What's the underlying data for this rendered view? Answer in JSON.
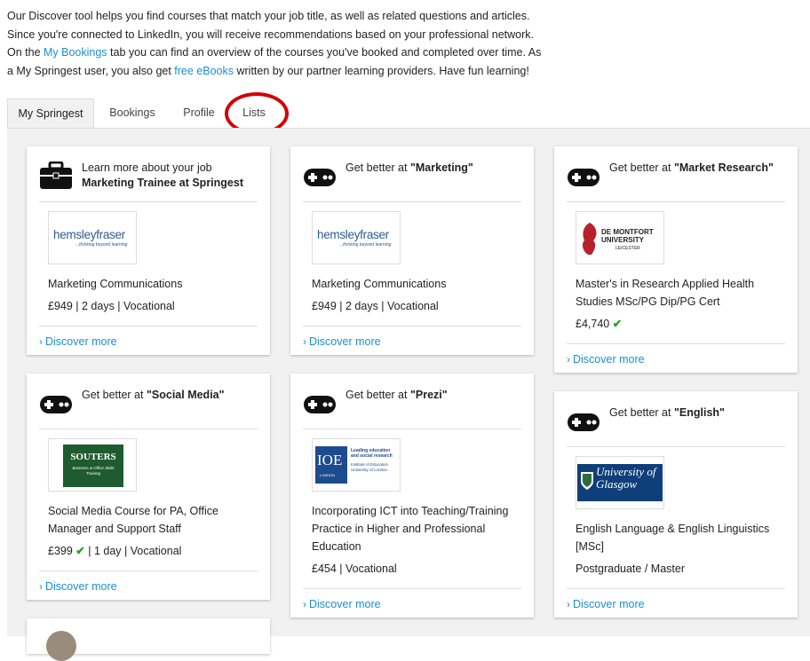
{
  "intro": {
    "part1": "Our Discover tool helps you find courses that match your job title, as well as related questions and articles. Since you're connected to LinkedIn, you will receive recommendations based on your professional network. On the ",
    "link1": "My Bookings",
    "part2": " tab you can find an overview of the courses you've booked and completed over time. As a My Springest user, you also get ",
    "link2": "free eBooks",
    "part3": " written by our partner learning providers. Have fun learning!"
  },
  "tabs": [
    {
      "label": "My Springest",
      "active": true
    },
    {
      "label": "Bookings",
      "active": false
    },
    {
      "label": "Profile",
      "active": false
    },
    {
      "label": "Lists",
      "active": false
    }
  ],
  "cards": [
    {
      "icon": "briefcase-icon",
      "head_line1": "Learn more about your job",
      "head_line2": "Marketing Trainee at Springest",
      "provider_logo": "hemsleyfraser-logo",
      "logo_text_main": "hemsleyfraser",
      "logo_text_sub": "...thinking beyond learning",
      "title": "Marketing Communications",
      "meta": "£949 | 2 days | Vocational",
      "discover": "Discover more"
    },
    {
      "icon": "gamepad-icon",
      "head_prefix": "Get better at ",
      "head_topic": "\"Marketing\"",
      "provider_logo": "hemsleyfraser-logo",
      "logo_text_main": "hemsleyfraser",
      "logo_text_sub": "...thinking beyond learning",
      "title": "Marketing Communications",
      "meta": "£949 | 2 days | Vocational",
      "discover": "Discover more"
    },
    {
      "icon": "gamepad-icon",
      "head_prefix": "Get better at ",
      "head_topic": "\"Market Research\"",
      "provider_logo": "de-montfort-university-logo",
      "logo_text_main": "DE MONTFORT UNIVERSITY",
      "logo_text_sub": "LEICESTER",
      "title": "Master's in Research Applied Health Studies MSc/PG Dip/PG Cert",
      "meta": "£4,740",
      "discover": "Discover more"
    },
    {
      "icon": "gamepad-icon",
      "head_prefix": "Get better at ",
      "head_topic": "\"Social Media\"",
      "provider_logo": "souters-logo",
      "logo_text_main": "SOUTERS",
      "logo_text_sub": "Business & Office Skills Training",
      "title": "Social Media Course for PA, Office Manager and Support Staff",
      "meta_price": "£399",
      "meta_rest": " | 1 day | Vocational",
      "discover": "Discover more"
    },
    {
      "icon": "gamepad-icon",
      "head_prefix": "Get better at ",
      "head_topic": "\"Prezi\"",
      "provider_logo": "ioe-logo",
      "logo_text_main": "IOE",
      "logo_text_sub": "LONDON",
      "logo_tag1": "Leading education and social research",
      "logo_tag2": "Institute of Education University of London",
      "title": "Incorporating ICT into Teaching/Training Practice in Higher and Professional Education",
      "meta": "£454 | Vocational",
      "discover": "Discover more"
    },
    {
      "icon": "gamepad-icon",
      "head_prefix": "Get better at ",
      "head_topic": "\"English\"",
      "provider_logo": "university-of-glasgow-logo",
      "logo_text_main": "University of Glasgow",
      "title": "English Language & English Linguistics [MSc]",
      "meta": "Postgraduate / Master",
      "discover": "Discover more"
    }
  ],
  "colors": {
    "link": "#1a8fd1",
    "highlight_ring": "#d40000",
    "check": "#1aa51a",
    "panel_bg": "#f1f1f1"
  }
}
